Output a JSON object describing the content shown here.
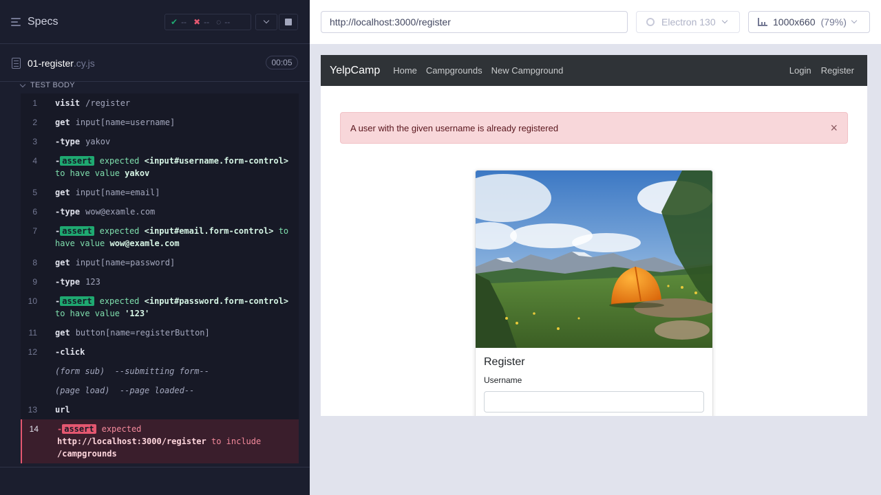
{
  "reporter": {
    "header": {
      "title": "Specs",
      "stats": {
        "passed": "--",
        "failed": "--",
        "pending": "--"
      }
    },
    "spec": {
      "name": "01-register",
      "ext": ".cy.js",
      "duration": "00:05"
    },
    "test_body_label": "TEST BODY",
    "commands": [
      {
        "num": "1",
        "method": "visit",
        "arg": "/register"
      },
      {
        "num": "2",
        "method": "get",
        "arg": "input[name=username]"
      },
      {
        "num": "3",
        "method": "-type",
        "arg": "yakov"
      },
      {
        "num": "4",
        "badge": "assert",
        "text_a": "expected ",
        "text_b": "<input#username.form-control>",
        "text_c": " to have value ",
        "text_d": "yakov"
      },
      {
        "num": "5",
        "method": "get",
        "arg": "input[name=email]"
      },
      {
        "num": "6",
        "method": "-type",
        "arg": "wow@examle.com"
      },
      {
        "num": "7",
        "badge": "assert",
        "text_a": "expected ",
        "text_b": "<input#email.form-control>",
        "text_c": " to have value ",
        "text_d": "wow@examle.com"
      },
      {
        "num": "8",
        "method": "get",
        "arg": "input[name=password]"
      },
      {
        "num": "9",
        "method": "-type",
        "arg": "123"
      },
      {
        "num": "10",
        "badge": "assert",
        "text_a": "expected ",
        "text_b": "<input#password.form-control>",
        "text_c": " to have value ",
        "text_d": "'123'"
      },
      {
        "num": "11",
        "method": "get",
        "arg": "button[name=registerButton]"
      },
      {
        "num": "12",
        "method": "-click",
        "arg": ""
      },
      {
        "event_a": "(form sub)",
        "event_b": "--submitting form--"
      },
      {
        "event_a": "(page load)",
        "event_b": "--page loaded--"
      },
      {
        "num": "13",
        "method": "url",
        "arg": ""
      },
      {
        "num": "14",
        "badge": "assert",
        "text_a": "expected",
        "text_b": "http://localhost:3000/register",
        "text_c": " to include ",
        "text_d": "/campgrounds"
      }
    ]
  },
  "aut": {
    "url": "http://localhost:3000/register",
    "browser": "Electron 130",
    "viewport": "1000x660",
    "viewport_scale": "(79%)",
    "app": {
      "brand": "YelpCamp",
      "nav_left": [
        "Home",
        "Campgrounds",
        "New Campground"
      ],
      "nav_right": [
        "Login",
        "Register"
      ],
      "alert": "A user with the given username is already registered",
      "alert_close": "×",
      "card_title": "Register",
      "username_label": "Username"
    }
  },
  "colors": {
    "pass": "#1fa971",
    "fail": "#e45770",
    "reporter_bg": "#1b1e2e",
    "alert_bg": "#f8d7da"
  },
  "icons": [
    "specs-menu-icon",
    "check-icon",
    "x-icon",
    "spinner-icon",
    "chevron-down-icon",
    "stop-icon",
    "file-icon",
    "browser-gear-icon",
    "ruler-icon",
    "close-icon"
  ]
}
